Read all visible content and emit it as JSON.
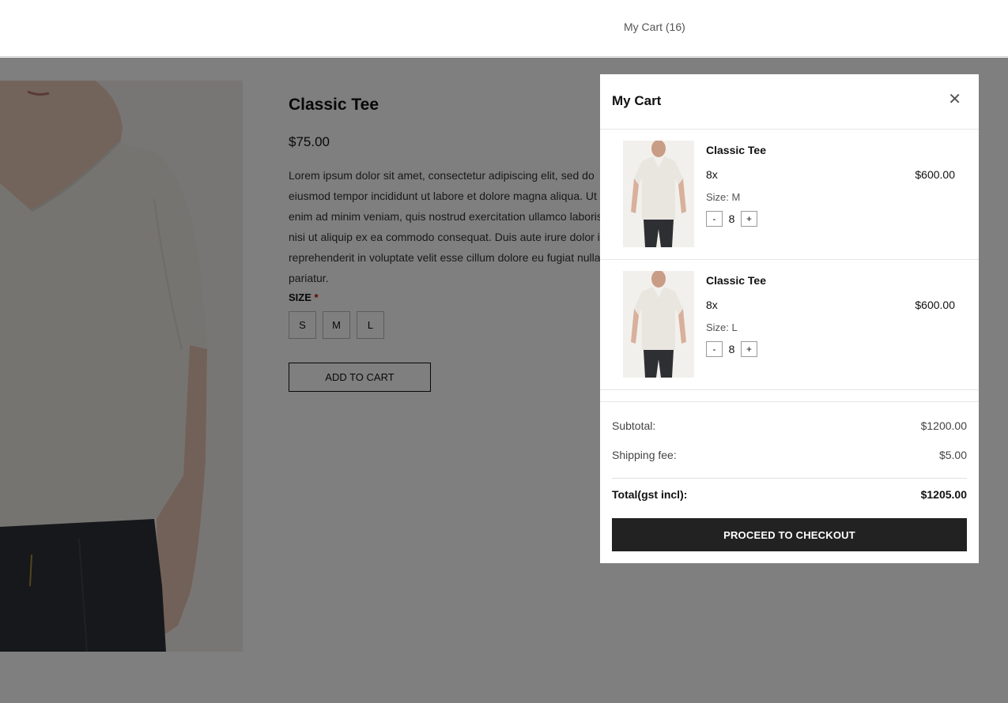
{
  "header": {
    "cart_link": "My Cart (16)"
  },
  "product": {
    "title": "Classic Tee",
    "price": "$75.00",
    "description": "Lorem ipsum dolor sit amet, consectetur adipiscing elit, sed do eiusmod tempor incididunt ut labore et dolore magna aliqua. Ut enim ad minim veniam, quis nostrud exercitation ullamco laboris nisi ut aliquip ex ea commodo consequat. Duis aute irure dolor in reprehenderit in voluptate velit esse cillum dolore eu fugiat nulla pariatur.",
    "size_label": "SIZE",
    "size_required_mark": "*",
    "sizes": [
      "S",
      "M",
      "L"
    ],
    "add_to_cart_label": "ADD TO CART"
  },
  "cart": {
    "title": "My Cart",
    "close_icon": "close-icon",
    "items": [
      {
        "name": "Classic Tee",
        "quantity_text": "8x",
        "price": "$600.00",
        "size": "Size: M",
        "stepper": {
          "minus": "-",
          "value": "8",
          "plus": "+"
        }
      },
      {
        "name": "Classic Tee",
        "quantity_text": "8x",
        "price": "$600.00",
        "size": "Size: L",
        "stepper": {
          "minus": "-",
          "value": "8",
          "plus": "+"
        }
      }
    ],
    "summary": {
      "subtotal_label": "Subtotal:",
      "subtotal_value": "$1200.00",
      "shipping_label": "Shipping fee:",
      "shipping_value": "$5.00",
      "total_label": "Total(gst incl):",
      "total_value": "$1205.00"
    },
    "checkout_label": "PROCEED TO CHECKOUT"
  },
  "colors": {
    "overlay": "rgba(0,0,0,0.5)",
    "checkout_bg": "#222222",
    "required": "#cc0000"
  }
}
